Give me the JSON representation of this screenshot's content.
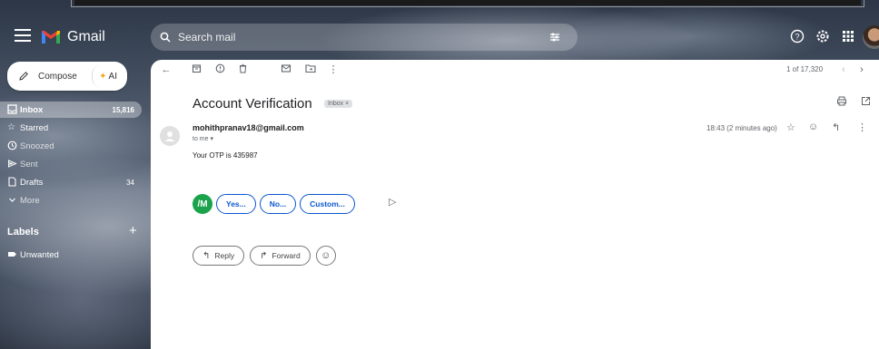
{
  "header": {
    "app_name": "Gmail",
    "search_placeholder": "Search mail",
    "avatar_icon": "user-avatar"
  },
  "sidebar": {
    "compose_label": "Compose",
    "ai_label": "AI",
    "items": [
      {
        "label": "Inbox",
        "count": "15,816",
        "icon": "inbox-icon"
      },
      {
        "label": "Starred",
        "count": "",
        "icon": "star-icon"
      },
      {
        "label": "Snoozed",
        "count": "",
        "icon": "clock-icon"
      },
      {
        "label": "Sent",
        "count": "",
        "icon": "send-icon"
      },
      {
        "label": "Drafts",
        "count": "34",
        "icon": "draft-icon"
      },
      {
        "label": "More",
        "count": "",
        "icon": "chevron-down-icon"
      }
    ],
    "labels_title": "Labels",
    "labels": [
      {
        "label": "Unwanted",
        "icon": "label-icon"
      }
    ]
  },
  "toolbar": {
    "pager": "1 of 17,320"
  },
  "email": {
    "subject": "Account Verification",
    "tag": "Inbox ×",
    "sender": "mohithpranav18@gmail.com",
    "to": "to me ▾",
    "time": "18:43 (2 minutes ago)",
    "body": "Your OTP is 435987"
  },
  "smart_replies": {
    "logo_text": "/M",
    "options": [
      "Yes...",
      "No...",
      "Custom..."
    ]
  },
  "actions": {
    "reply": "Reply",
    "forward": "Forward"
  }
}
